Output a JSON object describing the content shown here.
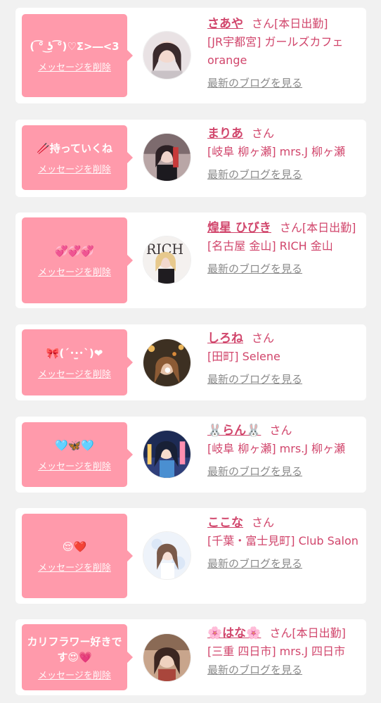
{
  "delete_label": "メッセージを削除",
  "blog_label": "最新のブログを見る",
  "items": [
    {
      "message": "( ͡° ͜ʖ ͡°)♡Σ>―<3",
      "name": "さあや",
      "suffix": "さん[本日出勤]",
      "shop": "[JR宇都宮] ガールズカフェ orange"
    },
    {
      "message": "🥢持っていくね",
      "name": "まりあ",
      "suffix": "さん",
      "shop": "[岐阜 柳ヶ瀬] mrs.J 柳ヶ瀬"
    },
    {
      "message": "💞💞💞",
      "name": "煌星 ひびき",
      "suffix": "さん[本日出勤]",
      "shop": "[名古屋 金山] RICH 金山"
    },
    {
      "message": "🎀(ˊ･·̫･ˋ)❤",
      "name": "しろね",
      "suffix": "さん",
      "shop": "[田町] Selene"
    },
    {
      "message": "🩵🦋🩵",
      "name": "🐰らん🐰",
      "suffix": "さん",
      "shop": "[岐阜 柳ヶ瀬] mrs.J 柳ヶ瀬"
    },
    {
      "message": "😌❤️",
      "name": "ここな",
      "suffix": "さん",
      "shop": "[千葉・富士見町] Club Salon"
    },
    {
      "message": "カリフラワー好きです😍💗",
      "name": "🌸はな🌸",
      "suffix": "さん[本日出勤]",
      "shop": "[三重 四日市] mrs.J 四日市"
    }
  ],
  "colors": {
    "background": "#f1f1f1",
    "bubble": "#ff9aab",
    "accent": "#d1466c",
    "link_gray": "#8a8a8a"
  }
}
